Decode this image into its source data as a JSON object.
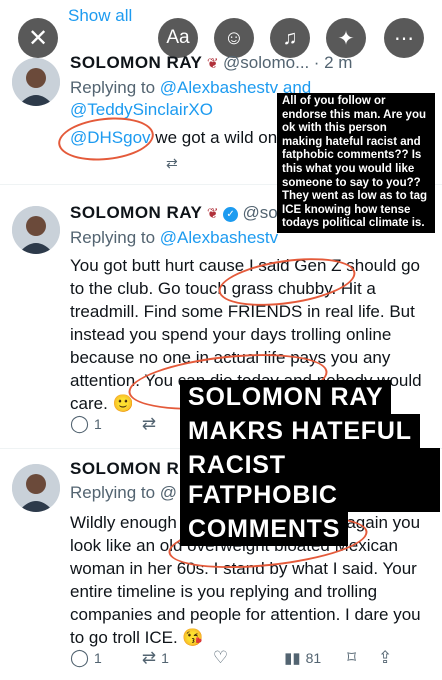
{
  "top": {
    "show_all": "Show all",
    "buttons": {
      "close": "✕",
      "text": "Aa",
      "sticker": "☺",
      "music": "♫",
      "effects": "✦",
      "more": "⋯"
    }
  },
  "tweets": [
    {
      "name": "SOLOMON RAY",
      "handle": "@solomo...",
      "time": "· 2 m",
      "replying_prefix": "Replying to ",
      "replying_to_1": "@Alexbashestv",
      "replying_and": " and",
      "replying_to_2": "@TeddySinclairXO",
      "mention": "@DHSgov",
      "text": " we got a wild one"
    },
    {
      "name": "SOLOMON RAY",
      "handle": "@so",
      "replying_prefix": "Replying to ",
      "replying_to_1": "@Alexbashestv",
      "lines": [
        "You got butt hurt cause I said Gen Z should go",
        "to the club. Go touch grass chubby. Hit a",
        "treadmill. Find some FRIENDS in real life. But",
        "instead you spend your days trolling online",
        "because no one in actual life pays you any",
        "attention. You can die today and nobody would",
        "care. 🙂"
      ],
      "reply_count": "1"
    },
    {
      "name": "SOLOMON RA",
      "replying_prefix": "Replying to @",
      "lines": [
        "Wildly enough that's how I look. And again you",
        "look like an old overweight bloated Mexican",
        "woman in her 60s. I stand by what I said. Your",
        "entire timeline is you replying and trolling",
        "companies and people for attention. I dare you",
        "to go troll ICE. 😘"
      ],
      "reply_count": "1",
      "retweet_count": "1",
      "views": "81"
    }
  ],
  "overlay": {
    "note": "All of you follow or endorse this man. Are you ok with this person making hateful racist and fatphobic comments?? Is this what you would like someone to say to you?? They went as low as to tag ICE knowing how tense todays political climate is.",
    "headline": [
      "SOLOMON RAY",
      "MAKRS HATEFUL",
      "RACIST FATPHOBIC",
      "COMMENTS"
    ]
  },
  "colors": {
    "link": "#1d9bf0",
    "muted": "#536471",
    "annotation": "#e45a3a",
    "verified": "#1d9bf0"
  }
}
